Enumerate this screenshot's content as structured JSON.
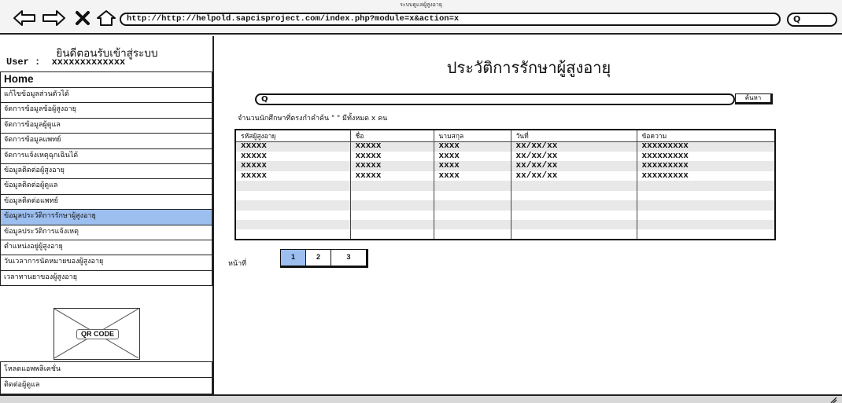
{
  "browser": {
    "window_title": "ระบบดูแลผู้สูงอายุ",
    "url": "http://http://helpold.sapcisproject.com/index.php?module=x&action=x",
    "search_glyph": "Q",
    "icons": [
      "back-arrow-icon",
      "forward-arrow-icon",
      "close-icon",
      "home-icon",
      "search-icon"
    ]
  },
  "sidebar": {
    "welcome": "ยินดีตอนรับเข้าสู่ระบบ",
    "user_line": "User :  xxxxxxxxxxxxx",
    "home": "Home",
    "items": [
      {
        "label": "แก้ไขข้อมูลส่วนตัวได้"
      },
      {
        "label": "จัดการข้อมูลข้อผู้สูงอายุ"
      },
      {
        "label": "จัดการข้อมูลผู้ดูแล"
      },
      {
        "label": "จัดการข้อมูลแพทย์"
      },
      {
        "label": "จัดการแจ้งเหตุฉุกเฉินได้"
      },
      {
        "label": "ข้อมูลติดต่อผู้สูงอายุ"
      },
      {
        "label": "ข้อมูลติดต่อผู้ดูแล"
      },
      {
        "label": "ข้อมูลติดต่อแพทย์"
      },
      {
        "label": "ข้อมูลประวัติการรักษาผู้สูงอายุ",
        "active": true
      },
      {
        "label": "ข้อมูลประวัติการแจ้งเหตุ"
      },
      {
        "label": "ตำแหน่งอยู่ผู้สูงอายุ"
      },
      {
        "label": "วันเวลาการนัดหมายของผู้สูงอายุ"
      },
      {
        "label": "เวลาทานยาของผู้สูงอายุ"
      }
    ],
    "qr_label": "QR CODE",
    "bottom_items": [
      {
        "label": "โหลดแอพพลิเคชั่น"
      },
      {
        "label": "ติดต่อผู้ดูแล"
      }
    ]
  },
  "main": {
    "title": "ประวัติการรักษาผู้สูงอายุ",
    "search": {
      "glyph": "Q",
      "button": "ค้นหา"
    },
    "result_text": "จำนวนนักศึกษาที่ตรงกำคำค้น \" \" มีทั้งหมด x คน",
    "table": {
      "columns": [
        "รหัสผู้สูงอายุ",
        "ชื่อ",
        "นามสกุล",
        "วันที่",
        "ข้อความ"
      ],
      "rows": [
        [
          "xxxxx",
          "xxxxx",
          "xxxx",
          "xx/xx/xx",
          "xxxxxxxxx"
        ],
        [
          "xxxxx",
          "xxxxx",
          "xxxx",
          "xx/xx/xx",
          "xxxxxxxxx"
        ],
        [
          "xxxxx",
          "xxxxx",
          "xxxx",
          "xx/xx/xx",
          "xxxxxxxxx"
        ],
        [
          "xxxxx",
          "xxxxx",
          "xxxx",
          "xx/xx/xx",
          "xxxxxxxxx"
        ],
        [
          "",
          "",
          "",
          "",
          ""
        ],
        [
          "",
          "",
          "",
          "",
          ""
        ],
        [
          "",
          "",
          "",
          "",
          ""
        ],
        [
          "",
          "",
          "",
          "",
          ""
        ],
        [
          "",
          "",
          "",
          "",
          ""
        ],
        [
          "",
          "",
          "",
          "",
          ""
        ]
      ]
    },
    "pager": {
      "label": "หน้าที่",
      "pages": [
        "1",
        "2",
        "3"
      ],
      "current": "1"
    }
  },
  "colors": {
    "highlight": "#9dbff0",
    "row_stripe": "#e8e8e8",
    "border": "#111111"
  }
}
